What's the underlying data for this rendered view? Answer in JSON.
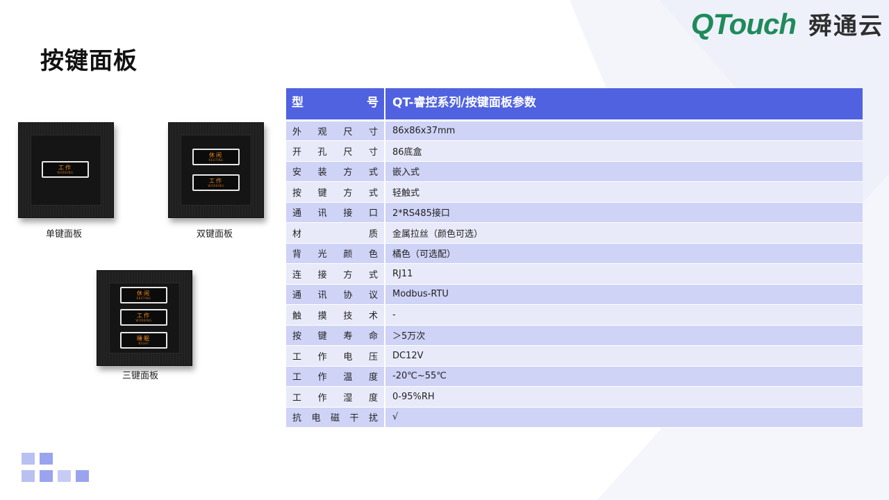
{
  "header": {
    "brand": "QTouch",
    "brand_cn": "舜通云"
  },
  "page": {
    "title": "按键面板"
  },
  "panels": {
    "single": {
      "caption": "单键面板",
      "keys": [
        {
          "cn": "工作",
          "en": "WORKING"
        }
      ]
    },
    "double": {
      "caption": "双键面板",
      "keys": [
        {
          "cn": "休闲",
          "en": "RESTING"
        },
        {
          "cn": "工作",
          "en": "WORKING"
        }
      ]
    },
    "triple": {
      "caption": "三键面板",
      "keys": [
        {
          "cn": "休闲",
          "en": "RESTING"
        },
        {
          "cn": "工作",
          "en": "WORKING"
        },
        {
          "cn": "睡眠",
          "en": "NIGHT"
        }
      ]
    }
  },
  "spec_table": {
    "header": {
      "param": "型号",
      "value": "QT-睿控系列/按键面板参数"
    },
    "rows": [
      {
        "param": "外观尺寸",
        "value": "86x86x37mm"
      },
      {
        "param": "开孔尺寸",
        "value": "86底盒"
      },
      {
        "param": "安装方式",
        "value": "嵌入式"
      },
      {
        "param": "按键方式",
        "value": "轻触式"
      },
      {
        "param": "通讯接口",
        "value": "2*RS485接口"
      },
      {
        "param": "材质",
        "value": "金属拉丝（颜色可选）"
      },
      {
        "param": "背光颜色",
        "value": "橘色（可选配）"
      },
      {
        "param": "连接方式",
        "value": "RJ11"
      },
      {
        "param": "通讯协议",
        "value": "Modbus-RTU"
      },
      {
        "param": "触摸技术",
        "value": "-"
      },
      {
        "param": "按键寿命",
        "value": "＞5万次"
      },
      {
        "param": "工作电压",
        "value": "DC12V"
      },
      {
        "param": "工作温度",
        "value": "-20℃~55℃"
      },
      {
        "param": "工作湿度",
        "value": "0-95%RH"
      },
      {
        "param": "抗电磁干扰",
        "value": "√"
      }
    ]
  },
  "colors": {
    "brand_green": "#1f8a5b",
    "header_blue": "#5062e0",
    "row_dark": "#cfd3f6",
    "row_light": "#e8eaf9",
    "backlight_orange": "#f08a1e"
  }
}
